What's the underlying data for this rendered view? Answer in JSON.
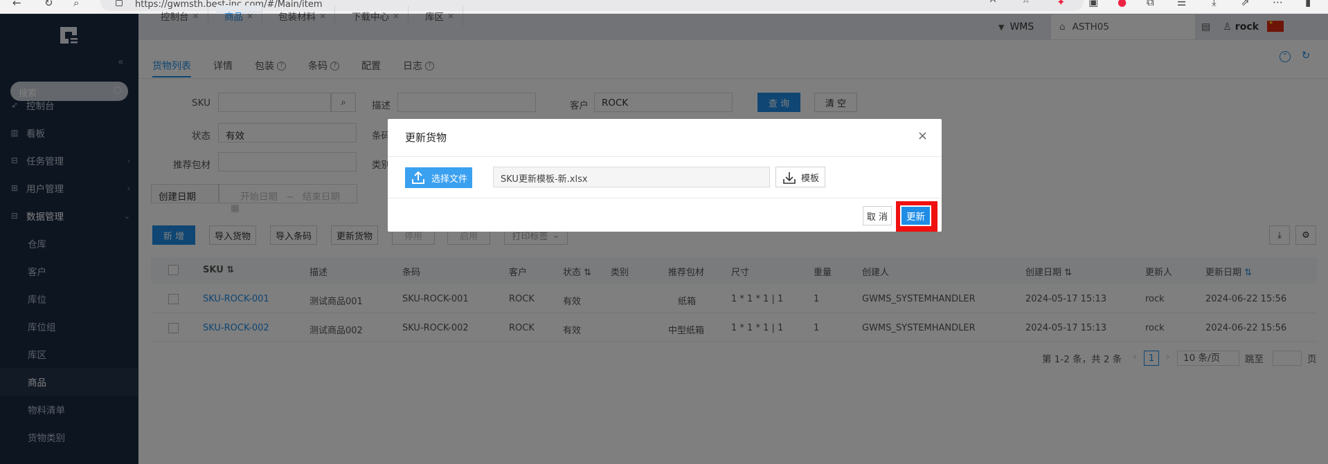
{
  "browser": {
    "url": "https://gwmsth.best-inc.com/#/Main/item",
    "zoom_label": "A⁾"
  },
  "sidebar": {
    "search_placeholder": "搜索",
    "menu": [
      {
        "label": "控制台"
      },
      {
        "label": "看板"
      },
      {
        "label": "任务管理"
      },
      {
        "label": "用户管理"
      },
      {
        "label": "数据管理"
      }
    ],
    "sub": [
      {
        "label": "仓库"
      },
      {
        "label": "客户"
      },
      {
        "label": "库位"
      },
      {
        "label": "库位组"
      },
      {
        "label": "库区"
      },
      {
        "label": "商品"
      },
      {
        "label": "物料清单"
      },
      {
        "label": "货物类别"
      }
    ]
  },
  "tabs": [
    {
      "label": "控制台"
    },
    {
      "label": "商品"
    },
    {
      "label": "包装材料"
    },
    {
      "label": "下载中心"
    },
    {
      "label": "库区"
    }
  ],
  "header": {
    "system": "WMS",
    "warehouse": "ASTH05",
    "user": "rock"
  },
  "subtabs": [
    {
      "label": "货物列表"
    },
    {
      "label": "详情"
    },
    {
      "label": "包装"
    },
    {
      "label": "条码"
    },
    {
      "label": "配置"
    },
    {
      "label": "日志"
    }
  ],
  "filters": {
    "sku_label": "SKU",
    "desc_label": "描述",
    "customer_label": "客户",
    "customer_value": "ROCK",
    "status_label": "状态",
    "status_value": "有效",
    "barcode_label": "条码",
    "pack_label": "推荐包材",
    "category_label": "类别",
    "created_label": "创建日期",
    "start_placeholder": "开始日期",
    "range_sep": "~",
    "end_placeholder": "结束日期",
    "search_btn": "查 询",
    "clear_btn": "清 空"
  },
  "toolbar": {
    "add": "新 增",
    "import_goods": "导入货物",
    "import_barcode": "导入条码",
    "update_goods": "更新货物",
    "disable": "停用",
    "enable": "启用",
    "print_label": "打印标签"
  },
  "table": {
    "headers": [
      "SKU",
      "描述",
      "条码",
      "客户",
      "状态",
      "类别",
      "推荐包材",
      "尺寸",
      "重量",
      "创建人",
      "创建日期",
      "更新人",
      "更新日期"
    ],
    "rows": [
      [
        "SKU-ROCK-001",
        "测试商品001",
        "SKU-ROCK-001",
        "ROCK",
        "有效",
        "",
        "纸箱",
        "1 * 1 * 1 | 1",
        "1",
        "GWMS_SYSTEMHANDLER",
        "2024-05-17 15:13",
        "rock",
        "2024-06-22 15:56"
      ],
      [
        "SKU-ROCK-002",
        "测试商品002",
        "SKU-ROCK-002",
        "ROCK",
        "有效",
        "",
        "中型纸箱",
        "1 * 1 * 1 | 1",
        "1",
        "GWMS_SYSTEMHANDLER",
        "2024-05-17 15:13",
        "rock",
        "2024-06-22 15:56"
      ]
    ]
  },
  "pager": {
    "summary": "第 1-2 条，共 2 条",
    "page": "1",
    "page_size": "10 条/页",
    "jump_label": "跳至",
    "page_unit": "页"
  },
  "modal": {
    "title": "更新货物",
    "choose_file": "选择文件",
    "file_name": "SKU更新模板-新.xlsx",
    "template": "模板",
    "cancel": "取 消",
    "update": "更新"
  },
  "colors": {
    "primary": "#1f8de6",
    "sidebar": "#1b2a43",
    "highlight": "#f01010"
  }
}
